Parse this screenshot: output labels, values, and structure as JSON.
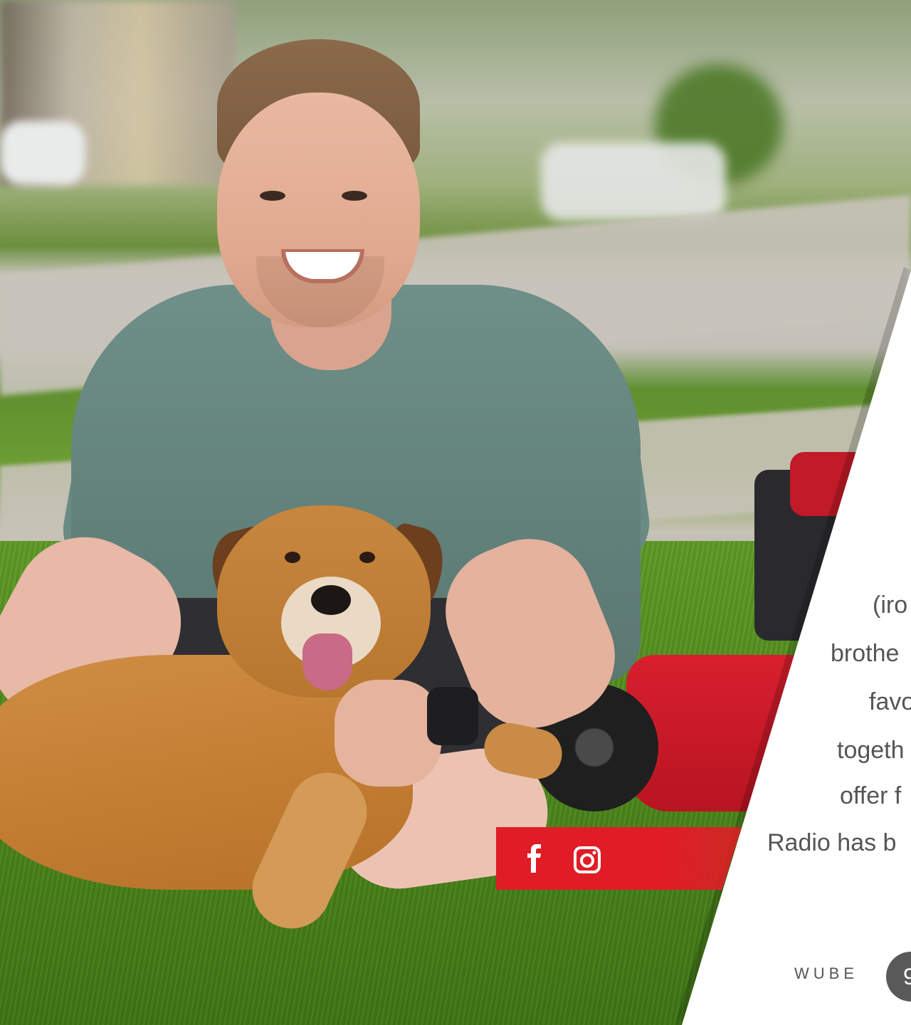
{
  "hero": {
    "photo_alt": "Man and dog sitting on lawn beside red mower"
  },
  "panel": {
    "lines": [
      "(iro",
      "brothe",
      "favo",
      "togeth",
      "offer f",
      "Radio has b"
    ]
  },
  "social": {
    "icons": [
      "facebook-icon",
      "instagram-icon"
    ],
    "bar_color": "#e01d26"
  },
  "footer": {
    "brand": "WUBE",
    "circle_label": "9"
  }
}
